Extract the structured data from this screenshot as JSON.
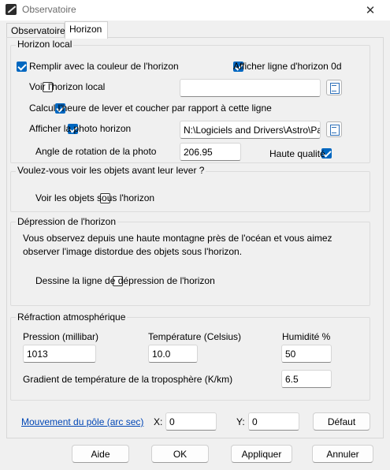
{
  "window": {
    "title": "Observatoire",
    "close_glyph": "✕"
  },
  "tabs": [
    {
      "label": "Observatoire"
    },
    {
      "label": "Horizon"
    }
  ],
  "horizon_local": {
    "title": "Horizon local",
    "fill_color": {
      "label": "Remplir avec la couleur de l'horizon",
      "checked": true
    },
    "show_line_0d": {
      "label": "Afficher ligne d'horizon 0d",
      "checked": true
    },
    "show_local": {
      "label": "Voir l'horizon local",
      "checked": false,
      "value": ""
    },
    "calc_rise_set": {
      "label": "Calcul l'heure de lever et coucher par rapport à cette ligne",
      "checked": true
    },
    "show_photo": {
      "label": "Afficher la photo horizon",
      "checked": true,
      "value": "N:\\Logiciels and Drivers\\Astro\\Panoramas"
    },
    "rotation": {
      "label": "Angle de rotation de la photo",
      "value": "206.95"
    },
    "high_quality": {
      "label": "Haute qualité",
      "checked": true
    }
  },
  "before_rise": {
    "title": "Voulez-vous voir les objets avant leur lever ?",
    "show_below": {
      "label": "Voir les objets sous l'horizon",
      "checked": false
    }
  },
  "depression": {
    "title": "Dépression de l'horizon",
    "description_1": "Vous observez depuis une haute montagne près de l'océan et vous aimez",
    "description_2": "observer l'image distordue des objets sous l'horizon.",
    "draw_line": {
      "label": "Dessine la ligne de dépression de l'horizon",
      "checked": false
    }
  },
  "refraction": {
    "title": "Réfraction atmosphérique",
    "pressure": {
      "label": "Pression (millibar)",
      "value": "1013"
    },
    "temperature": {
      "label": "Température (Celsius)",
      "value": "10.0"
    },
    "humidity": {
      "label": "Humidité %",
      "value": "50"
    },
    "gradient": {
      "label": "Gradient de température de la troposphère (K/km)",
      "value": "6.5"
    }
  },
  "pole_motion": {
    "link": "Mouvement du pôle (arc sec)",
    "x_label": "X:",
    "x_value": "0",
    "y_label": "Y:",
    "y_value": "0",
    "default_button": "Défaut"
  },
  "footer": {
    "help": "Aide",
    "ok": "OK",
    "apply": "Appliquer",
    "cancel": "Annuler"
  },
  "colors": {
    "accent": "#0067c0",
    "link": "#0046b5",
    "background": "#f0f0f0"
  },
  "icons": {
    "browse": "browse-folder-icon",
    "app": "app-icon"
  }
}
